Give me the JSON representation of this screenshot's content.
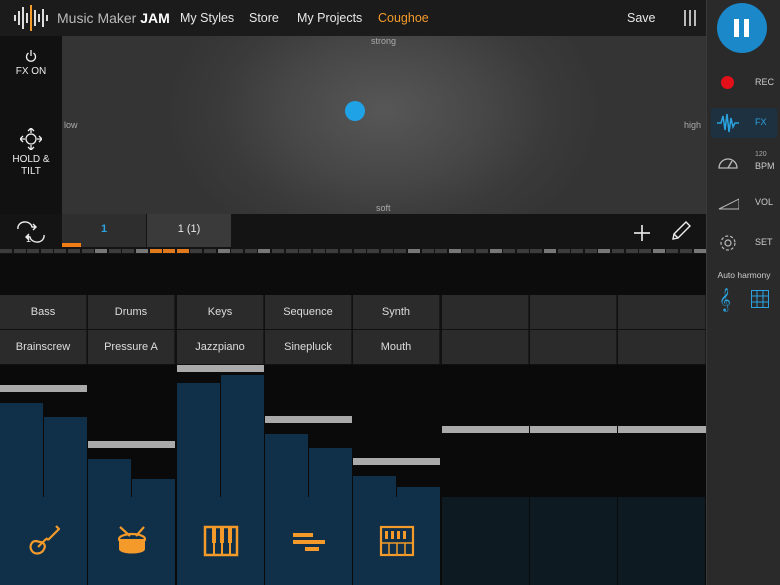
{
  "app": {
    "brand_light": "Music Maker ",
    "brand_bold": "JAM"
  },
  "nav": {
    "my_styles": "My Styles",
    "store": "Store",
    "my_projects": "My Projects",
    "current_project": "Coughoe",
    "save": "Save"
  },
  "sidebar": {
    "rec": "REC",
    "fx": "FX",
    "bpm_value": "120",
    "bpm_label": "BPM",
    "vol": "VOL",
    "set": "SET",
    "auto_harmony": "Auto harmony"
  },
  "fx": {
    "fx_on": "FX ON",
    "hold_tilt_line1": "HOLD &",
    "hold_tilt_line2": "TILT",
    "top": "strong",
    "bottom": "soft",
    "left": "low",
    "right": "high"
  },
  "parts": {
    "selected": "1",
    "other": "1 (1)",
    "progress_fraction": 0.23
  },
  "instrument_types": [
    "Bass",
    "Drums",
    "Keys",
    "Sequence",
    "Synth",
    "",
    "",
    ""
  ],
  "instrument_presets": [
    "Brainscrew",
    "Pressure A",
    "Jazzpiano",
    "Sinepluck",
    "Mouth",
    "",
    "",
    ""
  ],
  "mixer_levels": [
    0.84,
    0.38,
    1.0,
    0.58,
    0.24,
    0.5,
    0.5,
    0.5
  ],
  "tracks_active": [
    true,
    true,
    true,
    true,
    true,
    false,
    false,
    false
  ],
  "track_icons": [
    "guitar-icon",
    "drum-icon",
    "piano-icon",
    "sequence-icon",
    "synth-icon"
  ],
  "colors": {
    "accent_orange": "#f39a2b",
    "accent_blue": "#1a88c9",
    "rec_red": "#e3101a"
  }
}
